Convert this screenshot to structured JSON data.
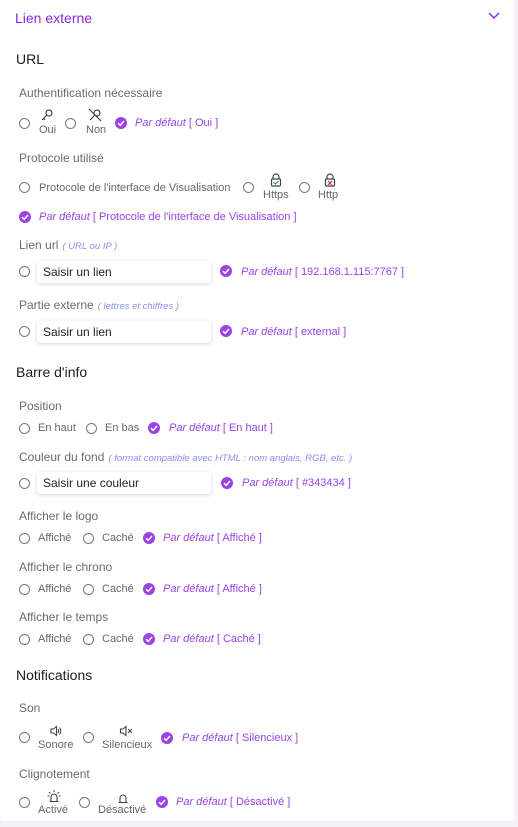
{
  "header": {
    "title": "Lien externe"
  },
  "colors": {
    "accent": "#9b42e8",
    "header": "#8a2be2",
    "hint": "#8a8ef0"
  },
  "url_section": {
    "title": "URL",
    "auth": {
      "label": "Authentification nécessaire",
      "opt_yes": "Oui",
      "opt_no": "Non",
      "default_prefix": "Par défaut",
      "default_value": "[ Oui ]"
    },
    "protocol": {
      "label": "Protocole utilisé",
      "opt_interface": "Protocole de l'interface de Visualisation",
      "opt_https": "Https",
      "opt_http": "Http",
      "default_prefix": "Par défaut",
      "default_value": "[ Protocole de l'interface de Visualisation ]"
    },
    "link": {
      "label": "Lien url",
      "hint": "( URL ou IP )",
      "placeholder": "Saisir un lien",
      "default_prefix": "Par défaut",
      "default_value": "[ 192.168.1.115:7767 ]"
    },
    "external": {
      "label": "Partie externe",
      "hint": "( lettres et chiffres )",
      "placeholder": "Saisir un lien",
      "default_prefix": "Par défaut",
      "default_value": "[ external ]"
    }
  },
  "info_section": {
    "title": "Barre d'info",
    "position": {
      "label": "Position",
      "opt_top": "En haut",
      "opt_bottom": "En bas",
      "default_prefix": "Par défaut",
      "default_value": "[ En haut ]"
    },
    "bg_color": {
      "label": "Couleur du fond",
      "hint": "( format compatible avec HTML : nom anglais, RGB, etc. )",
      "placeholder": "Saisir une couleur",
      "default_prefix": "Par défaut",
      "default_value": "[ #343434 ]"
    },
    "logo": {
      "label": "Afficher le logo",
      "opt_shown": "Affiché",
      "opt_hidden": "Caché",
      "default_prefix": "Par défaut",
      "default_value": "[ Affiché ]"
    },
    "chrono": {
      "label": "Afficher le chrono",
      "opt_shown": "Affiché",
      "opt_hidden": "Caché",
      "default_prefix": "Par défaut",
      "default_value": "[ Affiché ]"
    },
    "time": {
      "label": "Afficher le temps",
      "opt_shown": "Affiché",
      "opt_hidden": "Caché",
      "default_prefix": "Par défaut",
      "default_value": "[ Caché ]"
    }
  },
  "notif_section": {
    "title": "Notifications",
    "sound": {
      "label": "Son",
      "opt_sound": "Sonore",
      "opt_silent": "Silencieux",
      "default_prefix": "Par défaut",
      "default_value": "[ Silencieux ]"
    },
    "blink": {
      "label": "Clignotement",
      "opt_on": "Activé",
      "opt_off": "Désactivé",
      "default_prefix": "Par défaut",
      "default_value": "[ Désactivé ]"
    }
  }
}
